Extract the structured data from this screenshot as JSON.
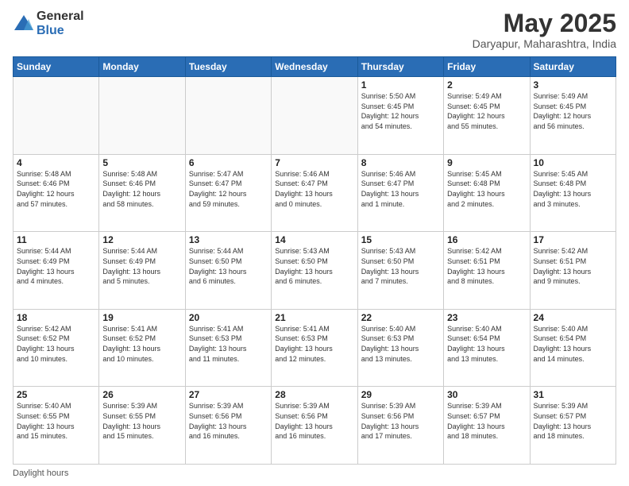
{
  "logo": {
    "general": "General",
    "blue": "Blue"
  },
  "title": "May 2025",
  "subtitle": "Daryapur, Maharashtra, India",
  "days_of_week": [
    "Sunday",
    "Monday",
    "Tuesday",
    "Wednesday",
    "Thursday",
    "Friday",
    "Saturday"
  ],
  "footer": "Daylight hours",
  "weeks": [
    [
      {
        "day": "",
        "info": ""
      },
      {
        "day": "",
        "info": ""
      },
      {
        "day": "",
        "info": ""
      },
      {
        "day": "",
        "info": ""
      },
      {
        "day": "1",
        "info": "Sunrise: 5:50 AM\nSunset: 6:45 PM\nDaylight: 12 hours\nand 54 minutes."
      },
      {
        "day": "2",
        "info": "Sunrise: 5:49 AM\nSunset: 6:45 PM\nDaylight: 12 hours\nand 55 minutes."
      },
      {
        "day": "3",
        "info": "Sunrise: 5:49 AM\nSunset: 6:45 PM\nDaylight: 12 hours\nand 56 minutes."
      }
    ],
    [
      {
        "day": "4",
        "info": "Sunrise: 5:48 AM\nSunset: 6:46 PM\nDaylight: 12 hours\nand 57 minutes."
      },
      {
        "day": "5",
        "info": "Sunrise: 5:48 AM\nSunset: 6:46 PM\nDaylight: 12 hours\nand 58 minutes."
      },
      {
        "day": "6",
        "info": "Sunrise: 5:47 AM\nSunset: 6:47 PM\nDaylight: 12 hours\nand 59 minutes."
      },
      {
        "day": "7",
        "info": "Sunrise: 5:46 AM\nSunset: 6:47 PM\nDaylight: 13 hours\nand 0 minutes."
      },
      {
        "day": "8",
        "info": "Sunrise: 5:46 AM\nSunset: 6:47 PM\nDaylight: 13 hours\nand 1 minute."
      },
      {
        "day": "9",
        "info": "Sunrise: 5:45 AM\nSunset: 6:48 PM\nDaylight: 13 hours\nand 2 minutes."
      },
      {
        "day": "10",
        "info": "Sunrise: 5:45 AM\nSunset: 6:48 PM\nDaylight: 13 hours\nand 3 minutes."
      }
    ],
    [
      {
        "day": "11",
        "info": "Sunrise: 5:44 AM\nSunset: 6:49 PM\nDaylight: 13 hours\nand 4 minutes."
      },
      {
        "day": "12",
        "info": "Sunrise: 5:44 AM\nSunset: 6:49 PM\nDaylight: 13 hours\nand 5 minutes."
      },
      {
        "day": "13",
        "info": "Sunrise: 5:44 AM\nSunset: 6:50 PM\nDaylight: 13 hours\nand 6 minutes."
      },
      {
        "day": "14",
        "info": "Sunrise: 5:43 AM\nSunset: 6:50 PM\nDaylight: 13 hours\nand 6 minutes."
      },
      {
        "day": "15",
        "info": "Sunrise: 5:43 AM\nSunset: 6:50 PM\nDaylight: 13 hours\nand 7 minutes."
      },
      {
        "day": "16",
        "info": "Sunrise: 5:42 AM\nSunset: 6:51 PM\nDaylight: 13 hours\nand 8 minutes."
      },
      {
        "day": "17",
        "info": "Sunrise: 5:42 AM\nSunset: 6:51 PM\nDaylight: 13 hours\nand 9 minutes."
      }
    ],
    [
      {
        "day": "18",
        "info": "Sunrise: 5:42 AM\nSunset: 6:52 PM\nDaylight: 13 hours\nand 10 minutes."
      },
      {
        "day": "19",
        "info": "Sunrise: 5:41 AM\nSunset: 6:52 PM\nDaylight: 13 hours\nand 10 minutes."
      },
      {
        "day": "20",
        "info": "Sunrise: 5:41 AM\nSunset: 6:53 PM\nDaylight: 13 hours\nand 11 minutes."
      },
      {
        "day": "21",
        "info": "Sunrise: 5:41 AM\nSunset: 6:53 PM\nDaylight: 13 hours\nand 12 minutes."
      },
      {
        "day": "22",
        "info": "Sunrise: 5:40 AM\nSunset: 6:53 PM\nDaylight: 13 hours\nand 13 minutes."
      },
      {
        "day": "23",
        "info": "Sunrise: 5:40 AM\nSunset: 6:54 PM\nDaylight: 13 hours\nand 13 minutes."
      },
      {
        "day": "24",
        "info": "Sunrise: 5:40 AM\nSunset: 6:54 PM\nDaylight: 13 hours\nand 14 minutes."
      }
    ],
    [
      {
        "day": "25",
        "info": "Sunrise: 5:40 AM\nSunset: 6:55 PM\nDaylight: 13 hours\nand 15 minutes."
      },
      {
        "day": "26",
        "info": "Sunrise: 5:39 AM\nSunset: 6:55 PM\nDaylight: 13 hours\nand 15 minutes."
      },
      {
        "day": "27",
        "info": "Sunrise: 5:39 AM\nSunset: 6:56 PM\nDaylight: 13 hours\nand 16 minutes."
      },
      {
        "day": "28",
        "info": "Sunrise: 5:39 AM\nSunset: 6:56 PM\nDaylight: 13 hours\nand 16 minutes."
      },
      {
        "day": "29",
        "info": "Sunrise: 5:39 AM\nSunset: 6:56 PM\nDaylight: 13 hours\nand 17 minutes."
      },
      {
        "day": "30",
        "info": "Sunrise: 5:39 AM\nSunset: 6:57 PM\nDaylight: 13 hours\nand 18 minutes."
      },
      {
        "day": "31",
        "info": "Sunrise: 5:39 AM\nSunset: 6:57 PM\nDaylight: 13 hours\nand 18 minutes."
      }
    ]
  ]
}
